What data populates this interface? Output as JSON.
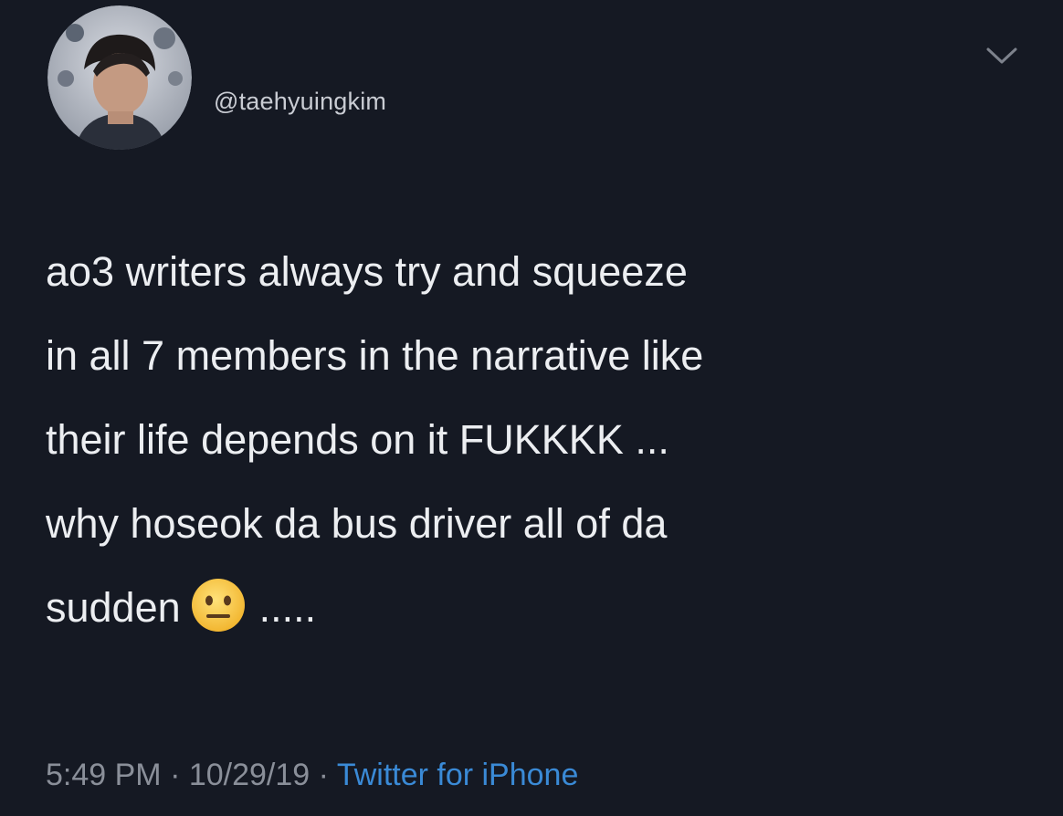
{
  "tweet": {
    "handle": "@taehyuingkim",
    "lines": [
      "ao3 writers always try and squeeze",
      "in all 7 members in the narrative like",
      "their life depends on it FUKKKK ...",
      "why hoseok da bus driver all of da"
    ],
    "last_line_start": "sudden",
    "last_line_end": ".....",
    "emoji": "neutral-face-emoji",
    "time": "5:49 PM",
    "separator": " · ",
    "date": "10/29/19",
    "source": "Twitter for iPhone"
  },
  "colors": {
    "background": "#151923",
    "text": "#eceef1",
    "secondary": "#8a8f99",
    "link": "#3a8ad6"
  }
}
